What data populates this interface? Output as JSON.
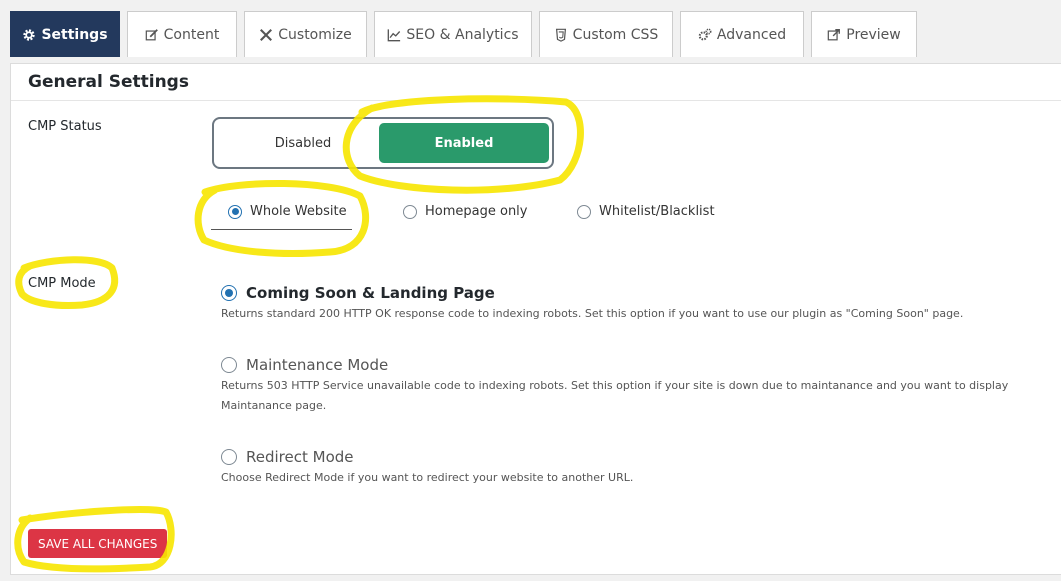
{
  "tabs": [
    {
      "label": "Settings",
      "icon": "gear-icon",
      "active": true
    },
    {
      "label": "Content",
      "icon": "edit-icon"
    },
    {
      "label": "Customize",
      "icon": "tools-icon"
    },
    {
      "label": "SEO & Analytics",
      "icon": "chart-icon"
    },
    {
      "label": "Custom CSS",
      "icon": "css3-icon"
    },
    {
      "label": "Advanced",
      "icon": "gears-icon"
    },
    {
      "label": "Preview",
      "icon": "external-link-icon"
    }
  ],
  "panel": {
    "title": "General Settings"
  },
  "cmp_status": {
    "label": "CMP Status",
    "toggle": {
      "disabled_label": "Disabled",
      "enabled_label": "Enabled",
      "selected": "Enabled"
    },
    "scope": {
      "options": [
        "Whole Website",
        "Homepage only",
        "Whitelist/Blacklist"
      ],
      "selected": "Whole Website"
    }
  },
  "cmp_mode": {
    "label": "CMP Mode",
    "selected": "Coming Soon & Landing Page",
    "options": [
      {
        "title": "Coming Soon & Landing Page",
        "description": "Returns standard 200 HTTP OK response code to indexing robots. Set this option if you want to use our plugin as \"Coming Soon\" page."
      },
      {
        "title": "Maintenance Mode",
        "description": "Returns 503 HTTP Service unavailable code to indexing robots. Set this option if your site is down due to maintanance and you want to display Maintanance page."
      },
      {
        "title": "Redirect Mode",
        "description": "Choose Redirect Mode if you want to redirect your website to another URL."
      }
    ]
  },
  "save_label": "SAVE ALL CHANGES",
  "colors": {
    "active_tab": "#23395d",
    "enabled": "#2a9a6b",
    "save": "#dc3545",
    "highlight": "#f7e600"
  }
}
